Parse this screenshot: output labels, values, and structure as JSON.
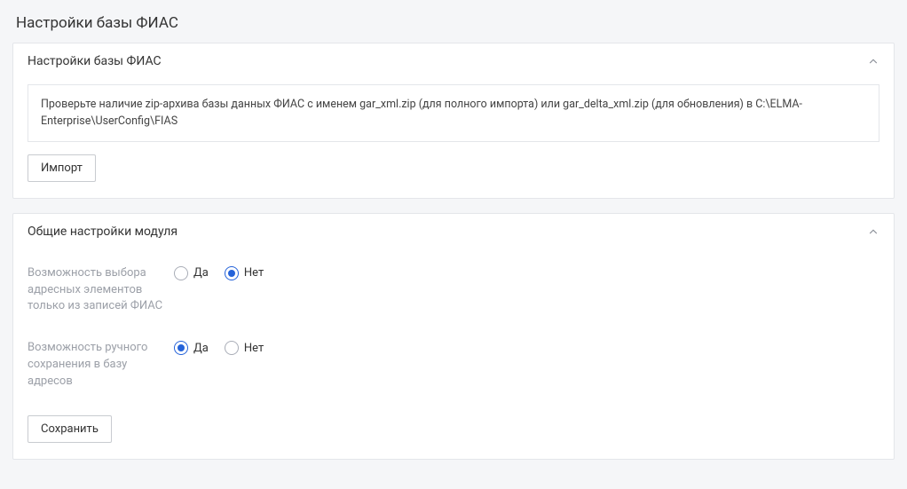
{
  "page_title": "Настройки базы ФИАС",
  "panel1": {
    "title": "Настройки базы ФИАС",
    "info_text": "Проверьте наличие zip-архива базы данных ФИАС с именем gar_xml.zip (для полного импорта) или gar_delta_xml.zip (для обновления) в C:\\ELMA-Enterprise\\UserConfig\\FIAS",
    "import_button": "Импорт"
  },
  "panel2": {
    "title": "Общие настройки модуля",
    "setting1": {
      "label": "Возможность выбора адресных элементов только из записей ФИАС",
      "yes": "Да",
      "no": "Нет",
      "value": "no"
    },
    "setting2": {
      "label": "Возможность ручного сохранения в базу адресов",
      "yes": "Да",
      "no": "Нет",
      "value": "yes"
    },
    "save_button": "Сохранить"
  }
}
